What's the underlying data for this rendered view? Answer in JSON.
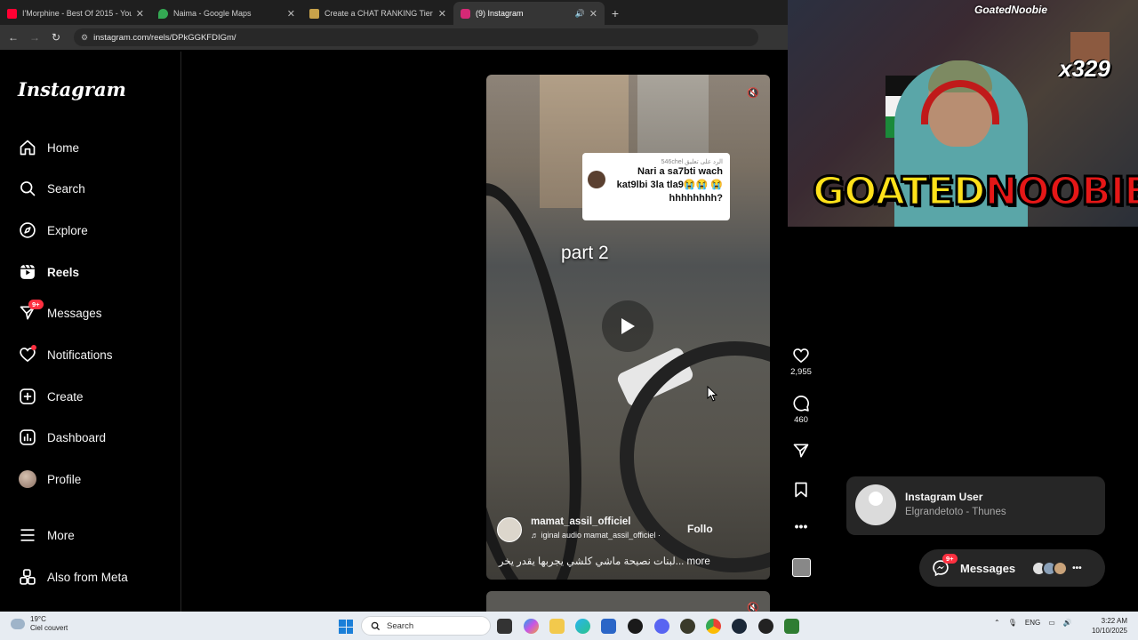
{
  "browser": {
    "tabs": [
      {
        "title": "I'Morphine - Best Of 2015 - You",
        "favicon_color": "#ff0033"
      },
      {
        "title": "Naima - Google Maps",
        "favicon_color": "#34a853"
      },
      {
        "title": "Create a CHAT RANKING Tier Li",
        "favicon_color": "#c8a24a"
      },
      {
        "title": "(9) Instagram",
        "favicon_color": "#d62976"
      }
    ],
    "new_tab": "+",
    "url": "instagram.com/reels/DPkGGKFDIGm/"
  },
  "sidebar": {
    "logo": "Instagram",
    "items": [
      {
        "label": "Home",
        "icon": "home-icon"
      },
      {
        "label": "Search",
        "icon": "search-icon"
      },
      {
        "label": "Explore",
        "icon": "compass-icon"
      },
      {
        "label": "Reels",
        "icon": "reels-icon"
      },
      {
        "label": "Messages",
        "icon": "messenger-icon",
        "badge": "9+"
      },
      {
        "label": "Notifications",
        "icon": "heart-icon"
      },
      {
        "label": "Create",
        "icon": "plus-square-icon"
      },
      {
        "label": "Dashboard",
        "icon": "dashboard-icon"
      },
      {
        "label": "Profile",
        "icon": "avatar"
      },
      {
        "label": "More",
        "icon": "menu-icon"
      },
      {
        "label": "Also from Meta",
        "icon": "meta-apps-icon"
      }
    ]
  },
  "reel": {
    "comment_reply_label": "الرد على تعليق",
    "comment_user": "546chel",
    "comment_text": "Nari a sa7bti wach kat9lbi 3la tla9😭😭 😭hhhhhhhh?",
    "overlay_text": "part 2",
    "author": "mamat_assil_officiel",
    "audio": "iginal audio  mamat_assil_officiel ·",
    "follow": "Follo",
    "caption": "لبنات نصيحة ماشي كلشي يجربها يقدر يخر... more"
  },
  "actions": {
    "likes": "2,955",
    "comments": "460"
  },
  "stream_overlay": {
    "handle": "GoatedNoobie",
    "multiplier": "x329",
    "banner_part1": "GOATED",
    "banner_part2": "NOOBIE",
    "colors": {
      "yellow": "#ffe11a",
      "red": "#e51717"
    }
  },
  "notification": {
    "title": "Instagram User",
    "subtitle": "Elgrandetoto - Thunes"
  },
  "messages_pill": {
    "label": "Messages",
    "badge": "9+"
  },
  "taskbar": {
    "weather_temp": "19°C",
    "weather_desc": "Ciel couvert",
    "search_placeholder": "Search",
    "lang": "ENG",
    "time": "3:22 AM",
    "date": "10/10/2025"
  }
}
